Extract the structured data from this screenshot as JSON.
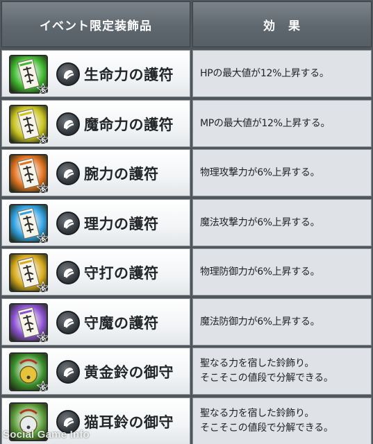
{
  "header": {
    "col_item": "イベント限定装飾品",
    "col_effect": "効　果"
  },
  "rows": [
    {
      "name": "生命力の護符",
      "effect": "HPの最大値が12%上昇する。",
      "icon": "green-talisman-icon",
      "color": "#3fb82f",
      "level": "6"
    },
    {
      "name": "魔命力の護符",
      "effect": "MPの最大値が12%上昇する。",
      "icon": "yellow-talisman-icon",
      "color": "#c9c21f",
      "level": "6"
    },
    {
      "name": "腕力の護符",
      "effect": "物理攻撃力が6%上昇する。",
      "icon": "orange-talisman-icon",
      "color": "#e0701f",
      "level": "6"
    },
    {
      "name": "理力の護符",
      "effect": "魔法攻撃力が6%上昇する。",
      "icon": "blue-talisman-icon",
      "color": "#2f9fe0",
      "level": "6"
    },
    {
      "name": "守打の護符",
      "effect": "物理防御力が6%上昇する。",
      "icon": "gold-talisman-icon",
      "color": "#d7a81a",
      "level": "6"
    },
    {
      "name": "守魔の護符",
      "effect": "魔法防御力が6%上昇する。",
      "icon": "purple-talisman-icon",
      "color": "#8a4fd0",
      "level": "6"
    },
    {
      "name": "黄金鈴の御守",
      "effect": "聖なる力を宿した鈴飾り。\nそこそこの値段で分解できる。",
      "icon": "golden-bell-charm-icon",
      "color": "#3a8f2a",
      "level": "6"
    },
    {
      "name": "猫耳鈴の御守",
      "effect": "聖なる力を宿した鈴飾り。\nそこそこの値段で分解できる。",
      "icon": "cat-bell-charm-icon",
      "color": "#5c9d3a",
      "level": ""
    }
  ],
  "watermark": "Social Game Info"
}
